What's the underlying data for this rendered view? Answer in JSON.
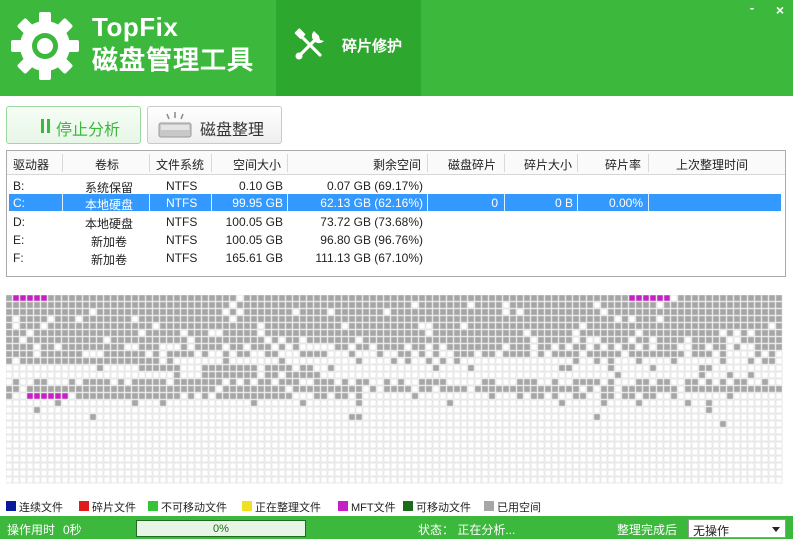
{
  "header": {
    "app_name": "TopFix",
    "app_subtitle": "磁盘管理工具",
    "nav_tab_label": "碎片修护",
    "minimize_glyph": "-",
    "close_glyph": "×",
    "brand_color": "#3cb83c",
    "active_tab_color": "#2ea72e"
  },
  "toolbar": {
    "stop_label": "停止分析",
    "defrag_label": "磁盘整理"
  },
  "drive_table": {
    "columns": [
      "驱动器",
      "卷标",
      "文件系统",
      "空间大小",
      "剩余空间",
      "磁盘碎片",
      "碎片大小",
      "碎片率",
      "上次整理时间"
    ],
    "rows": [
      {
        "drive": "B:",
        "label": "系统保留",
        "fs": "NTFS",
        "size": "0.10 GB",
        "free": "0.07 GB (69.17%)",
        "frag": "",
        "frag_size": "",
        "frag_rate": "",
        "last": "",
        "selected": false
      },
      {
        "drive": "C:",
        "label": "本地硬盘",
        "fs": "NTFS",
        "size": "99.95 GB",
        "free": "62.13 GB (62.16%)",
        "frag": "0",
        "frag_size": "0 B",
        "frag_rate": "0.00%",
        "last": "",
        "selected": true
      },
      {
        "drive": "D:",
        "label": "本地硬盘",
        "fs": "NTFS",
        "size": "100.05 GB",
        "free": "73.72 GB (73.68%)",
        "frag": "",
        "frag_size": "",
        "frag_rate": "",
        "last": "",
        "selected": false
      },
      {
        "drive": "E:",
        "label": "新加卷",
        "fs": "NTFS",
        "size": "100.05 GB",
        "free": "96.80 GB (96.76%)",
        "frag": "",
        "frag_size": "",
        "frag_rate": "",
        "last": "",
        "selected": false
      },
      {
        "drive": "F:",
        "label": "新加卷",
        "fs": "NTFS",
        "size": "165.61 GB",
        "free": "111.13 GB (67.10%)",
        "frag": "",
        "frag_size": "",
        "frag_rate": "",
        "last": "",
        "selected": false
      }
    ]
  },
  "cluster_map": {
    "colors": {
      "used": "#a6a6a6",
      "mft": "#c61fc6",
      "empty": "#ffffff",
      "grid": "#d9d9d9"
    }
  },
  "legend": [
    {
      "label": "连续文件",
      "color": "#0a1a9c"
    },
    {
      "label": "碎片文件",
      "color": "#e01b1b"
    },
    {
      "label": "不可移动文件",
      "color": "#35c435"
    },
    {
      "label": "正在整理文件",
      "color": "#f0e020"
    },
    {
      "label": "MFT文件",
      "color": "#c61fc6"
    },
    {
      "label": "可移动文件",
      "color": "#1a6b1a"
    },
    {
      "label": "已用空间",
      "color": "#a6a6a6"
    }
  ],
  "status": {
    "elapsed_label": "操作用时",
    "elapsed_value": "0秒",
    "progress_text": "0%",
    "progress_fraction": 0,
    "state_text": "状态： 正在分析...",
    "after_done_label": "整理完成后",
    "after_done_value": "无操作"
  }
}
